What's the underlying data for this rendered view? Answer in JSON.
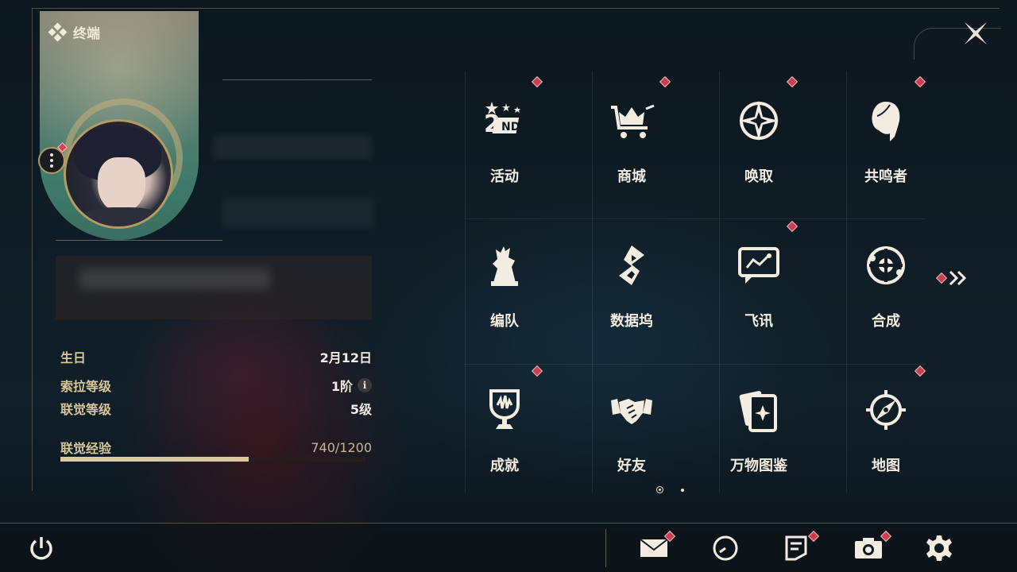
{
  "header": {
    "title": "终端"
  },
  "profile": {
    "birthday_label": "生日",
    "birthday_value": "2月12日",
    "sola_level_label": "索拉等级",
    "sola_level_value": "1阶",
    "union_level_label": "联觉等级",
    "union_level_value": "5级",
    "union_exp_label": "联觉经验",
    "union_exp_value": "740/1200",
    "union_exp_fraction": 0.6167
  },
  "menu": {
    "items": [
      {
        "label": "活动",
        "icon": "event-2nd-icon",
        "badge": true
      },
      {
        "label": "商城",
        "icon": "shop-crown-cart-icon",
        "badge": true
      },
      {
        "label": "唤取",
        "icon": "convene-compass-star-icon",
        "badge": true
      },
      {
        "label": "共鸣者",
        "icon": "resonator-head-icon",
        "badge": true
      },
      {
        "label": "编队",
        "icon": "team-chess-icon",
        "badge": false
      },
      {
        "label": "数据坞",
        "icon": "data-bank-icon",
        "badge": false
      },
      {
        "label": "飞讯",
        "icon": "message-chat-icon",
        "badge": true
      },
      {
        "label": "合成",
        "icon": "synthesis-icon",
        "badge": false
      },
      {
        "label": "成就",
        "icon": "achievement-trophy-icon",
        "badge": true
      },
      {
        "label": "好友",
        "icon": "friends-handshake-icon",
        "badge": false
      },
      {
        "label": "万物图鉴",
        "icon": "archive-card-icon",
        "badge": false
      },
      {
        "label": "地图",
        "icon": "map-compass-icon",
        "badge": true
      }
    ],
    "page_count": 2,
    "current_page": 1
  },
  "bottom": {
    "icons": [
      "power-icon",
      "mail-icon",
      "clock-icon",
      "notice-icon",
      "camera-icon",
      "settings-icon"
    ]
  },
  "colors": {
    "accent_gold": "#d8c79a",
    "badge_red": "#c94050",
    "text": "#f2ede0"
  }
}
